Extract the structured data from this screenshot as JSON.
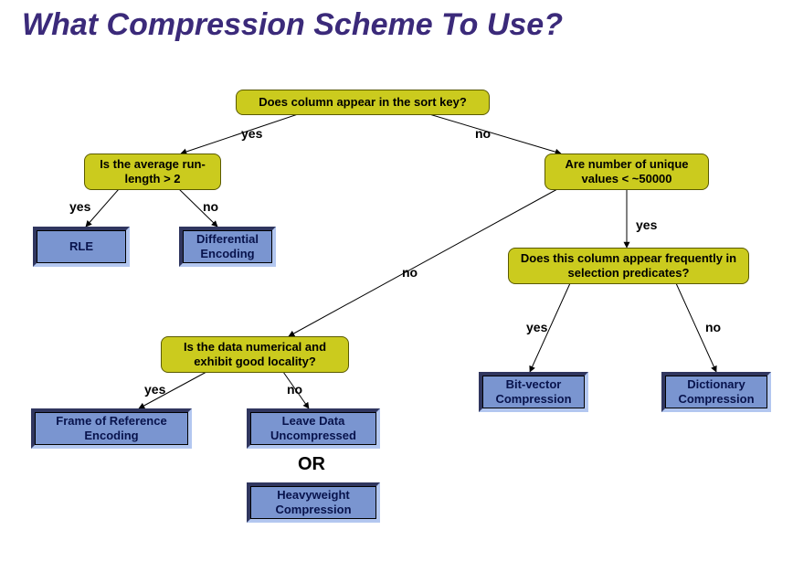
{
  "title": "What Compression Scheme To Use?",
  "nodes": {
    "q_sortkey": "Does column appear in the sort key?",
    "q_runlen": "Is the average run-length > 2",
    "q_unique": "Are number of unique values < ~50000",
    "q_selpred": "Does this column appear frequently in selection predicates?",
    "q_numloc": "Is the data numerical and exhibit good locality?",
    "l_rle": "RLE",
    "l_diff": "Differential Encoding",
    "l_frame": "Frame of Reference Encoding",
    "l_uncomp": "Leave Data Uncompressed",
    "l_heavy": "Heavyweight Compression",
    "l_bitvec": "Bit-vector Compression",
    "l_dict": "Dictionary Compression"
  },
  "labels": {
    "yes": "yes",
    "no": "no",
    "or": "OR"
  }
}
